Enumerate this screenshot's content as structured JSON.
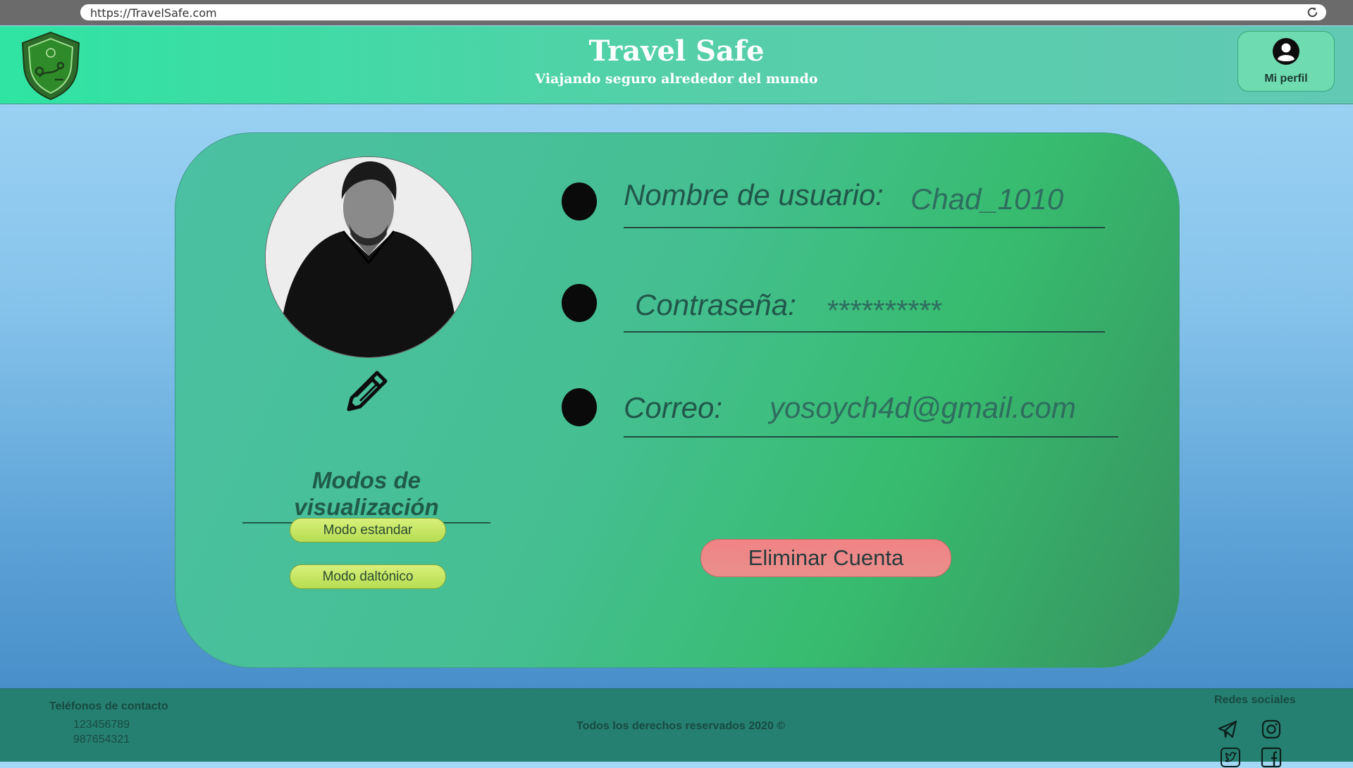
{
  "browser": {
    "url": "https://TravelSafe.com"
  },
  "header": {
    "title": "Travel Safe",
    "subtitle": "Viajando seguro alrededor del mundo",
    "profile_label": "Mi perfil"
  },
  "profile": {
    "fields": [
      {
        "label": "Nombre de usuario:",
        "value": "Chad_1010"
      },
      {
        "label": "Contraseña:",
        "value": "**********"
      },
      {
        "label": "Correo:",
        "value": "yosoych4d@gmail.com"
      }
    ],
    "modes_title": "Modos de visualización",
    "mode_standard": "Modo estandar",
    "mode_colorblind": "Modo daltónico",
    "delete_label": "Eliminar Cuenta"
  },
  "footer": {
    "phones_title": "Teléfonos de contacto",
    "phones": [
      "123456789",
      "987654321"
    ],
    "copyright": "Todos los derechos reservados 2020 ©",
    "social_title": "Redes sociales",
    "social": [
      "telegram-icon",
      "instagram-icon",
      "twitter-icon",
      "facebook-icon"
    ]
  },
  "colors": {
    "header_start": "#2fe4a3",
    "card": "#45bf92",
    "delete": "#f08385",
    "mode_button": "#c8e866",
    "footer": "#268071"
  }
}
